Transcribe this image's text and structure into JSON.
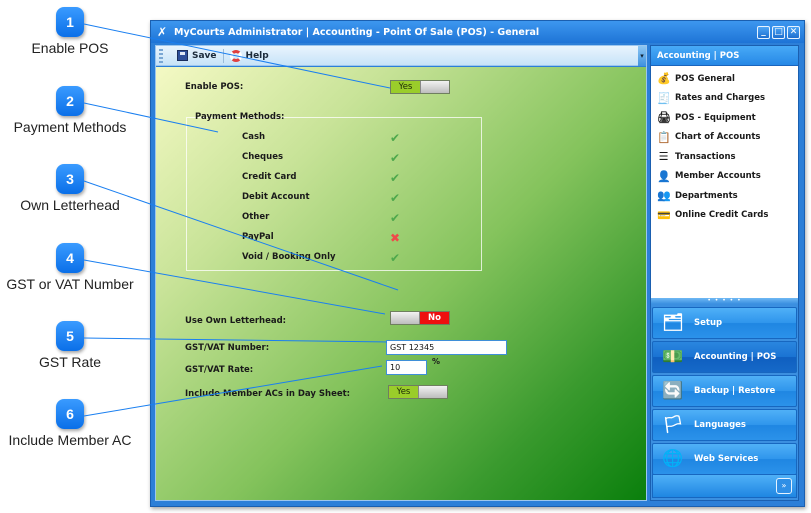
{
  "callouts": [
    {
      "number": "1",
      "label": "Enable POS"
    },
    {
      "number": "2",
      "label": "Payment Methods"
    },
    {
      "number": "3",
      "label": "Own Letterhead"
    },
    {
      "number": "4",
      "label": "GST or VAT Number"
    },
    {
      "number": "5",
      "label": "GST Rate"
    },
    {
      "number": "6",
      "label": "Include Member AC"
    }
  ],
  "window": {
    "title": "MyCourts Administrator | Accounting - Point Of Sale (POS) - General",
    "app_icon": "mycourts-logo-icon",
    "controls": {
      "minimize": "_",
      "maximize": "□",
      "close": "✕"
    }
  },
  "toolbar": {
    "save_label": "Save",
    "help_label": "Help",
    "overflow_glyph": "▾"
  },
  "form": {
    "enable_pos": {
      "label": "Enable POS:",
      "value": "Yes",
      "state": true
    },
    "payment_methods": {
      "title": "Payment Methods:",
      "items": [
        {
          "label": "Cash",
          "enabled": true,
          "icon": "✔"
        },
        {
          "label": "Cheques",
          "enabled": true,
          "icon": "✔"
        },
        {
          "label": "Credit Card",
          "enabled": true,
          "icon": "✔"
        },
        {
          "label": "Debit Account",
          "enabled": true,
          "icon": "✔"
        },
        {
          "label": "Other",
          "enabled": true,
          "icon": "✔"
        },
        {
          "label": "PayPal",
          "enabled": false,
          "icon": "✖"
        },
        {
          "label": "Void / Booking Only",
          "enabled": true,
          "icon": "✔"
        }
      ]
    },
    "own_letterhead": {
      "label": "Use Own Letterhead:",
      "value": "No",
      "state": false
    },
    "gst_number": {
      "label": "GST/VAT Number:",
      "value": "GST 12345"
    },
    "gst_rate": {
      "label": "GST/VAT Rate:",
      "value": "10",
      "unit": "%"
    },
    "include_member_acs": {
      "label": "Include Member ACs in Day Sheet:",
      "value": "Yes",
      "state": true
    }
  },
  "nav": {
    "header": "Accounting | POS",
    "items": [
      {
        "label": "POS General",
        "icon": "pos-general-icon",
        "glyph": "💰"
      },
      {
        "label": "Rates and Charges",
        "icon": "rates-charges-icon",
        "glyph": "🧾"
      },
      {
        "label": "POS - Equipment",
        "icon": "pos-equipment-icon",
        "glyph": "🖨"
      },
      {
        "label": "Chart of Accounts",
        "icon": "chart-of-accounts-icon",
        "glyph": "📋"
      },
      {
        "label": "Transactions",
        "icon": "transactions-icon",
        "glyph": "☰"
      },
      {
        "label": "Member Accounts",
        "icon": "member-accounts-icon",
        "glyph": "👤"
      },
      {
        "label": "Departments",
        "icon": "departments-icon",
        "glyph": "👥"
      },
      {
        "label": "Online Credit Cards",
        "icon": "online-credit-cards-icon",
        "glyph": "💳"
      }
    ],
    "splitter": "• • • • •",
    "sections": [
      {
        "label": "Setup",
        "icon": "setup-icon",
        "glyph": "🗂",
        "active": false
      },
      {
        "label": "Accounting | POS",
        "icon": "accounting-icon",
        "glyph": "💵",
        "active": true
      },
      {
        "label": "Backup | Restore",
        "icon": "backup-restore-icon",
        "glyph": "🔄",
        "active": false
      },
      {
        "label": "Languages",
        "icon": "languages-icon",
        "glyph": "🏳",
        "active": false
      },
      {
        "label": "Web Services",
        "icon": "web-services-icon",
        "glyph": "🌐",
        "active": false
      }
    ],
    "more_glyph": "»"
  },
  "colors": {
    "callout_blue": "#1a7ff0",
    "titlebar_blue": "#2c7fd8",
    "toggle_on": "#9acd2a",
    "toggle_off": "#ee0f0f",
    "check_green": "#4ea84c",
    "cross_red": "#ef4a4a"
  }
}
